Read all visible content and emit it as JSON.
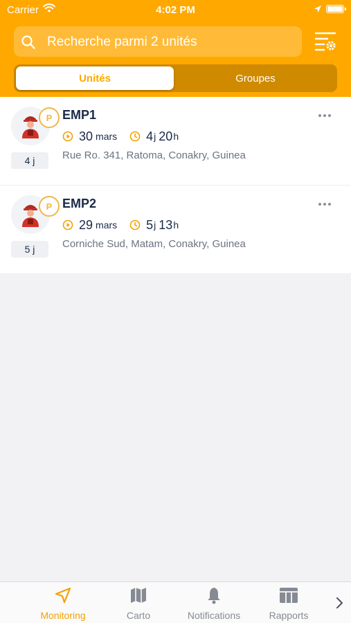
{
  "status_bar": {
    "carrier": "Carrier",
    "time": "4:02 PM"
  },
  "search": {
    "placeholder": "Recherche parmi 2 unités"
  },
  "segments": {
    "units": "Unités",
    "groups": "Groupes"
  },
  "units": [
    {
      "name": "EMP1",
      "badge": "P",
      "days": "4 j",
      "date_day": "30",
      "date_month": "mars",
      "dur1": "4",
      "dur1_unit": "j",
      "dur2": "20",
      "dur2_unit": "h",
      "address": "Rue Ro. 341, Ratoma, Conakry, Guinea"
    },
    {
      "name": "EMP2",
      "badge": "P",
      "days": "5 j",
      "date_day": "29",
      "date_month": "mars",
      "dur1": "5",
      "dur1_unit": "j",
      "dur2": "13",
      "dur2_unit": "h",
      "address": "Corniche Sud, Matam, Conakry, Guinea"
    }
  ],
  "tabs": {
    "monitoring": "Monitoring",
    "carto": "Carto",
    "notifications": "Notifications",
    "rapports": "Rapports"
  },
  "colors": {
    "accent": "#ffa800",
    "text": "#1a2a48",
    "muted": "#6b7380"
  },
  "icons": [
    "wifi-icon",
    "location-arrow-icon",
    "battery-icon",
    "search-icon",
    "filter-settings-icon",
    "person-icon",
    "play-icon",
    "clock-icon",
    "more-icon",
    "navigation-arrow-icon",
    "map-icon",
    "bell-icon",
    "table-icon",
    "chevron-right-icon"
  ]
}
